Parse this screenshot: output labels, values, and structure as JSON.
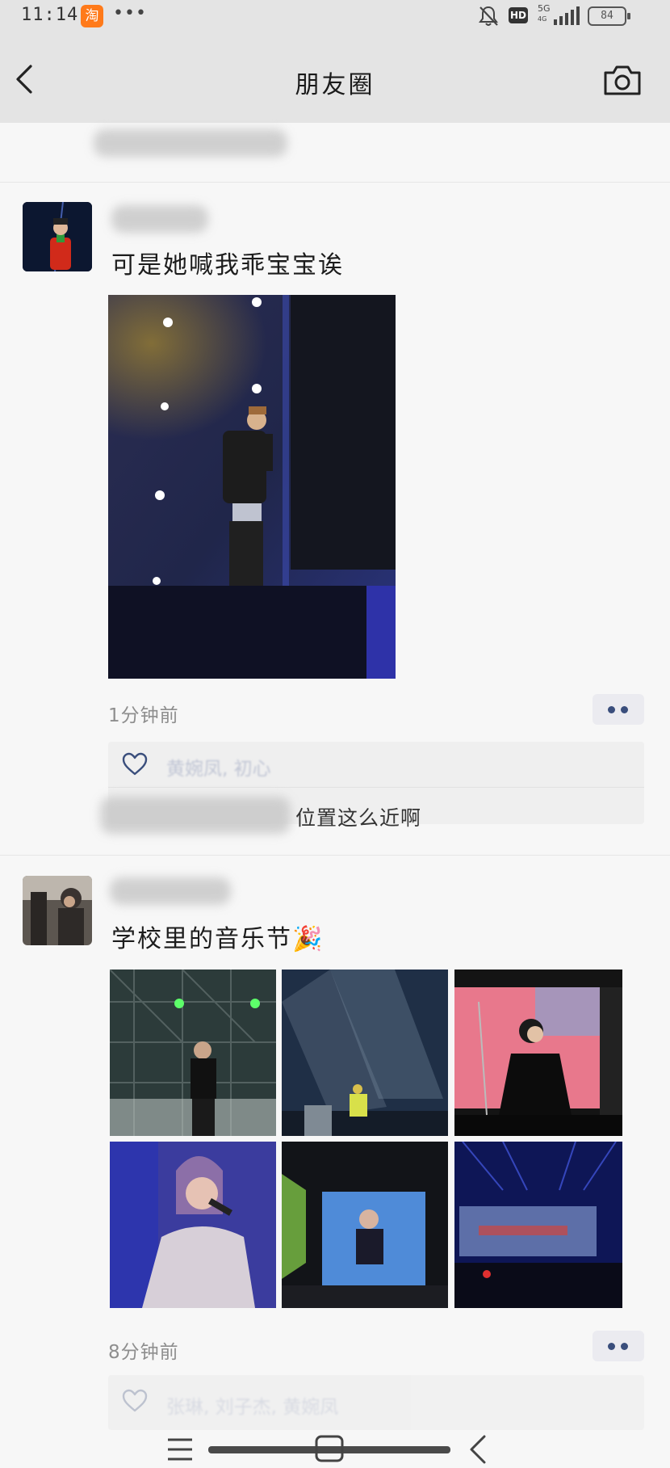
{
  "status_bar": {
    "time": "11:14",
    "app_icon_label": "淘",
    "more_indicator": "•••",
    "network_label": "5G",
    "network_sub": "4G",
    "battery": "84",
    "icons": [
      "mute-bell-icon",
      "hd-icon",
      "signal-icon",
      "battery-icon"
    ]
  },
  "nav": {
    "title": "朋友圈",
    "back_icon": "back-arrow-icon",
    "camera_icon": "camera-icon"
  },
  "posts": [
    {
      "text": "可是她喊我乖宝宝诶",
      "time": "1分钟前",
      "likes": "黄婉凤, 初心",
      "comment_tail": "位置这么近啊",
      "photo_count": 1
    },
    {
      "text": "学校里的音乐节🎉",
      "time": "8分钟前",
      "likes": "张琳, 刘子杰, 黄婉凤",
      "photo_count": 6
    }
  ],
  "colors": {
    "bar_background": "#e4e4e4",
    "page_background": "#f7f7f7",
    "link_blue": "#3a4e7c",
    "time_gray": "#8e8e8e"
  }
}
